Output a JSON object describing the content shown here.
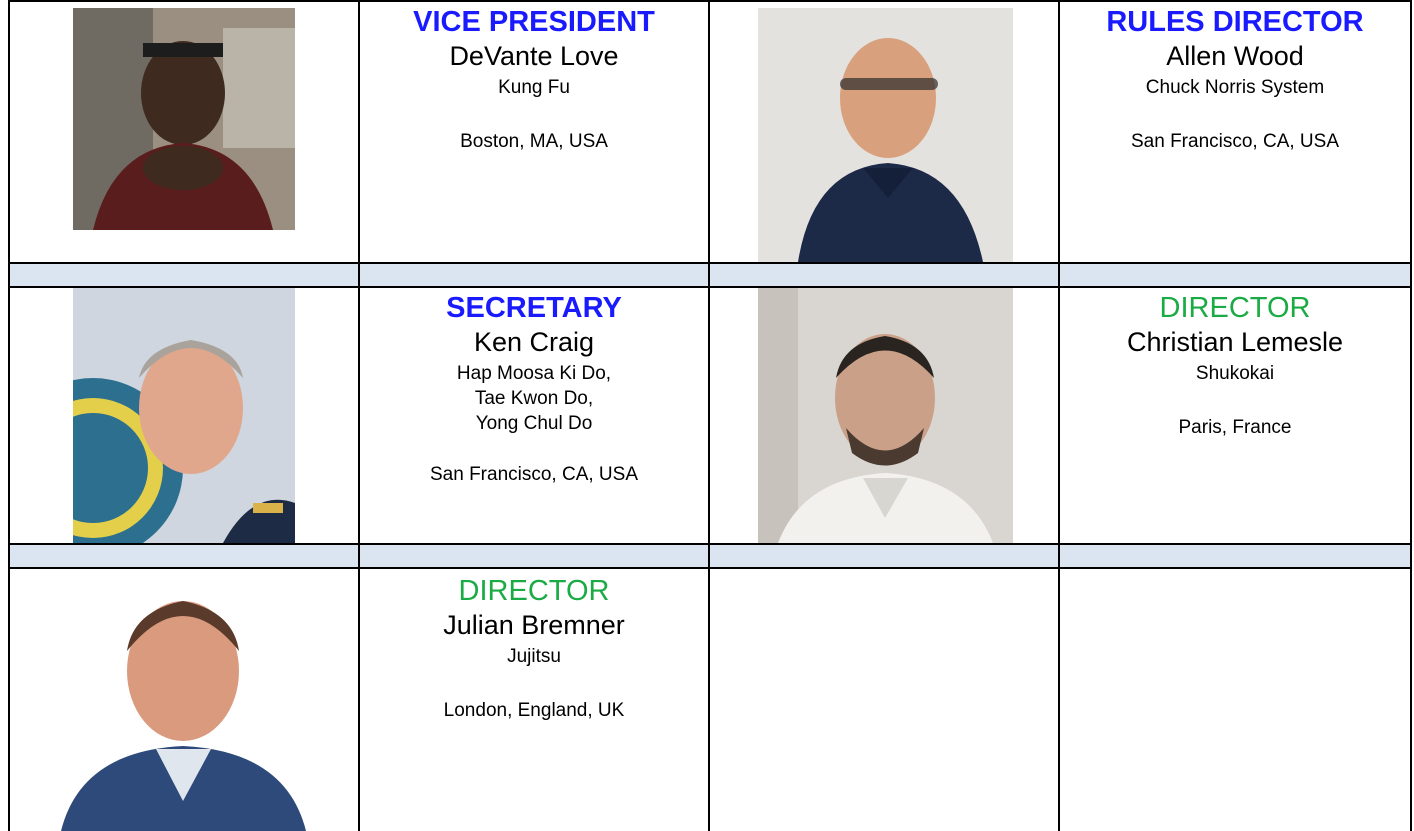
{
  "rows": [
    {
      "left": {
        "role": "VICE PRESIDENT",
        "role_style": "blue",
        "name": "DeVante Love",
        "style_lines": [
          "Kung Fu"
        ],
        "location": "Boston, MA, USA",
        "photo_icon": "portrait-photo"
      },
      "right": {
        "role": "RULES DIRECTOR",
        "role_style": "blue",
        "name": "Allen Wood",
        "style_lines": [
          "Chuck Norris System"
        ],
        "location": "San Francisco, CA, USA",
        "photo_icon": "portrait-photo"
      }
    },
    {
      "left": {
        "role": "SECRETARY",
        "role_style": "blue",
        "name": "Ken Craig",
        "style_lines": [
          "Hap Moosa Ki Do,",
          "Tae Kwon Do,",
          "Yong Chul Do"
        ],
        "location": "San Francisco, CA, USA",
        "photo_icon": "portrait-photo"
      },
      "right": {
        "role": "DIRECTOR",
        "role_style": "green",
        "name": "Christian Lemesle",
        "style_lines": [
          "Shukokai"
        ],
        "location": "Paris, France",
        "photo_icon": "portrait-photo"
      }
    },
    {
      "left": {
        "role": "DIRECTOR",
        "role_style": "green",
        "name": "Julian Bremner",
        "style_lines": [
          "Jujitsu"
        ],
        "location": "London, England, UK",
        "photo_icon": "portrait-photo"
      }
    }
  ],
  "colors": {
    "role_blue": "#1a1aff",
    "role_green": "#1bab45",
    "separator_band": "#dbe5f1",
    "border": "#000000"
  }
}
